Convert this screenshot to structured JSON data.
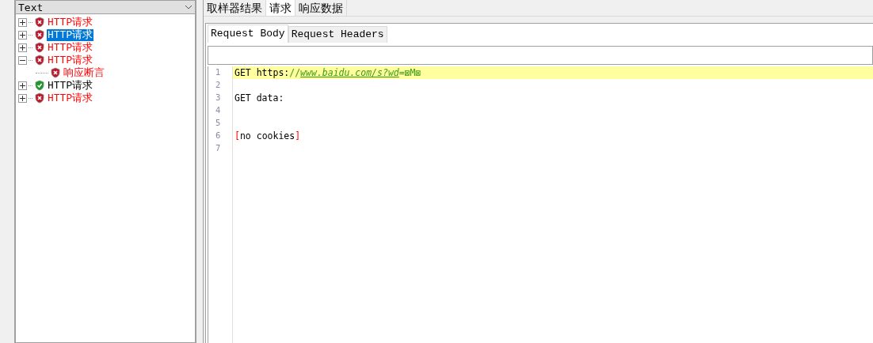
{
  "tree": {
    "header": "Text",
    "items": [
      {
        "label": "HTTP请求",
        "passed": false,
        "expanded": false,
        "selected": false
      },
      {
        "label": "HTTP请求",
        "passed": false,
        "expanded": false,
        "selected": true
      },
      {
        "label": "HTTP请求",
        "passed": false,
        "expanded": false,
        "selected": false
      },
      {
        "label": "HTTP请求",
        "passed": false,
        "expanded": true,
        "selected": false,
        "children": [
          {
            "label": "响应断言",
            "passed": false,
            "selected": false
          }
        ]
      },
      {
        "label": "HTTP请求",
        "passed": true,
        "expanded": false,
        "selected": false
      },
      {
        "label": "HTTP请求",
        "passed": false,
        "expanded": false,
        "selected": false
      }
    ]
  },
  "tabs": [
    {
      "label": "取样器结果",
      "selected": false
    },
    {
      "label": "请求",
      "selected": true
    },
    {
      "label": "响应数据",
      "selected": false
    }
  ],
  "subtabs": [
    {
      "label": "Request Body",
      "selected": true
    },
    {
      "label": "Request Headers",
      "selected": false
    }
  ],
  "editor": {
    "lines": [
      {
        "number": "1",
        "highlighted": true,
        "segments": [
          {
            "kind": "plain",
            "text": "GET https:"
          },
          {
            "kind": "green",
            "text": "//"
          },
          {
            "kind": "url",
            "text": "www.baidu.com/s?wd"
          },
          {
            "kind": "green",
            "text": "=⊠M⊠"
          }
        ]
      },
      {
        "number": "2",
        "highlighted": false
      },
      {
        "number": "3",
        "highlighted": false,
        "segments": [
          {
            "kind": "plain",
            "text": "GET data:"
          }
        ]
      },
      {
        "number": "4",
        "highlighted": false
      },
      {
        "number": "5",
        "highlighted": false
      },
      {
        "number": "6",
        "highlighted": false,
        "segments": [
          {
            "kind": "bracket",
            "text": "["
          },
          {
            "kind": "plain",
            "text": "no cookies"
          },
          {
            "kind": "bracket",
            "text": "]"
          }
        ]
      },
      {
        "number": "7",
        "highlighted": false
      }
    ]
  }
}
